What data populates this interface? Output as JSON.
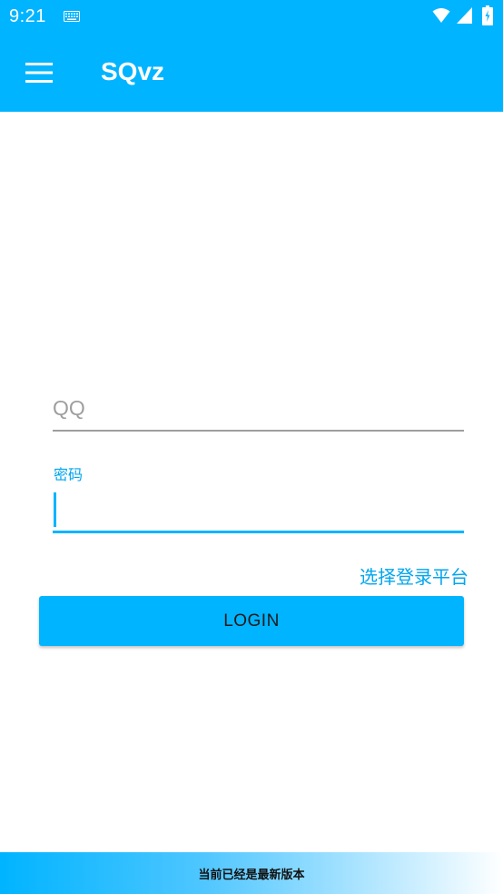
{
  "status_bar": {
    "time": "9:21",
    "icons": [
      "keyboard-icon",
      "wifi-icon",
      "signal-icon",
      "battery-icon"
    ]
  },
  "app_bar": {
    "title": "SQvz",
    "menu_icon": "menu-icon"
  },
  "form": {
    "qq_placeholder": "QQ",
    "qq_value": "",
    "password_label": "密码",
    "password_value": "",
    "platform_link": "选择登录平台",
    "login_label": "LOGIN"
  },
  "footer": {
    "version_status": "当前已经是最新版本"
  },
  "colors": {
    "primary": "#00b4ff",
    "accent_text": "#00a6ee",
    "underline_inactive": "#9e9e9e"
  }
}
